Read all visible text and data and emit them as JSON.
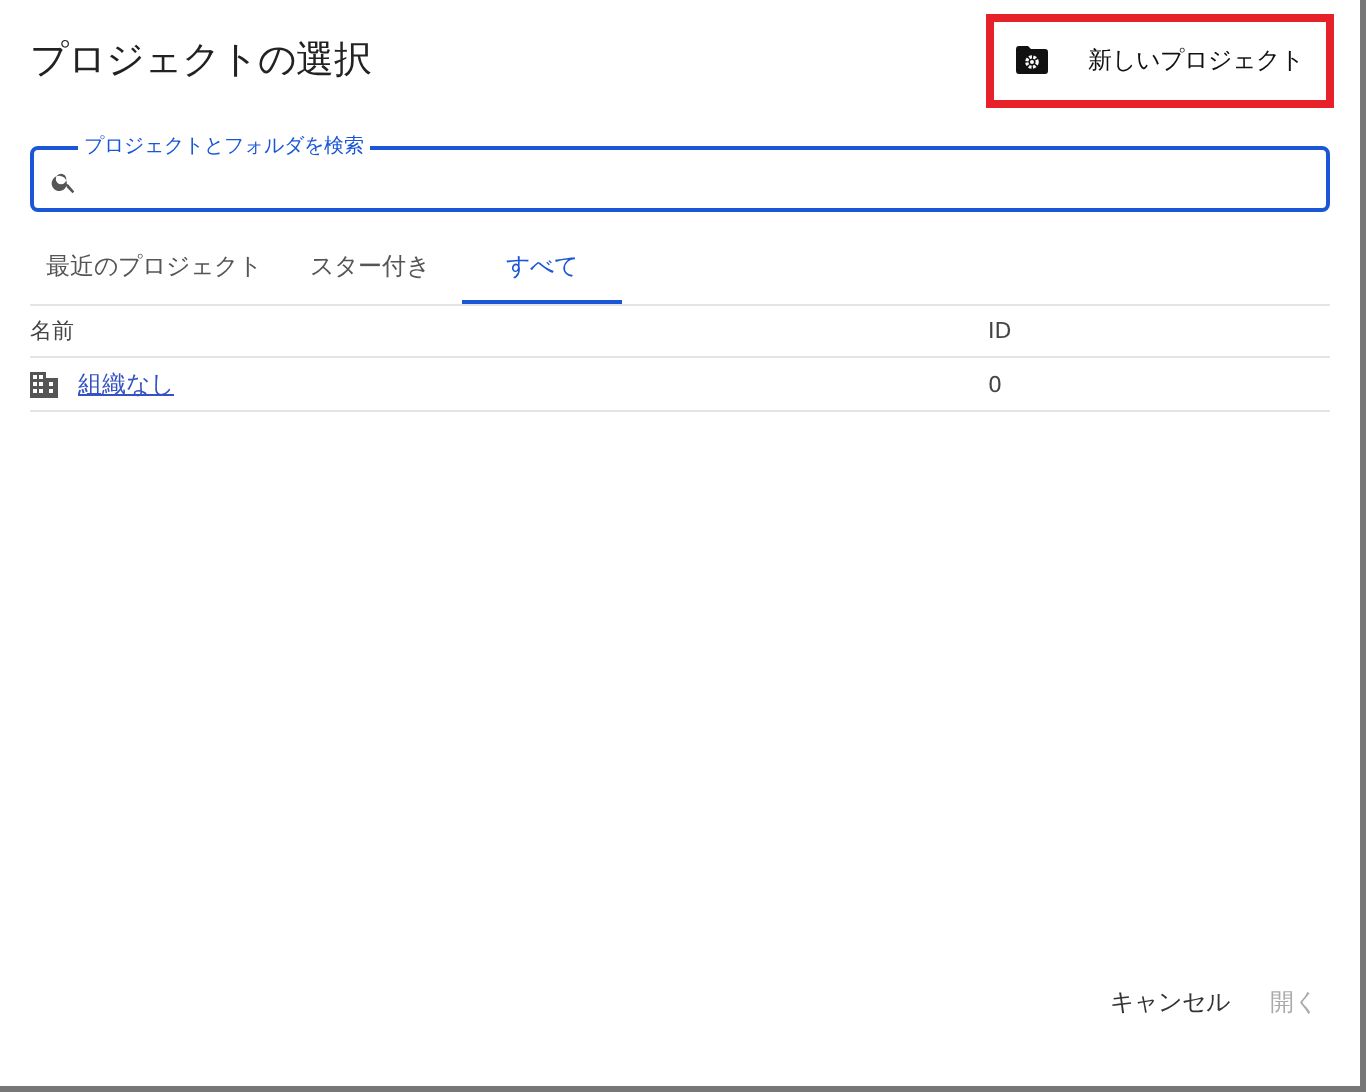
{
  "dialog": {
    "title": "プロジェクトの選択",
    "new_project_button": {
      "label": "新しいプロジェクト",
      "highlighted": true
    }
  },
  "search": {
    "label": "プロジェクトとフォルダを検索"
  },
  "tabs": [
    {
      "label": "最近のプロジェクト",
      "selected": false
    },
    {
      "label": "スター付き",
      "selected": false
    },
    {
      "label": "すべて",
      "selected": true
    }
  ],
  "table": {
    "columns": [
      "名前",
      "ID"
    ],
    "rows": [
      {
        "name": "組織なし",
        "id": "0"
      }
    ]
  },
  "buttons": [
    {
      "label": "キャンセル",
      "disabled": false
    },
    {
      "label": "開く",
      "disabled": true
    }
  ]
}
